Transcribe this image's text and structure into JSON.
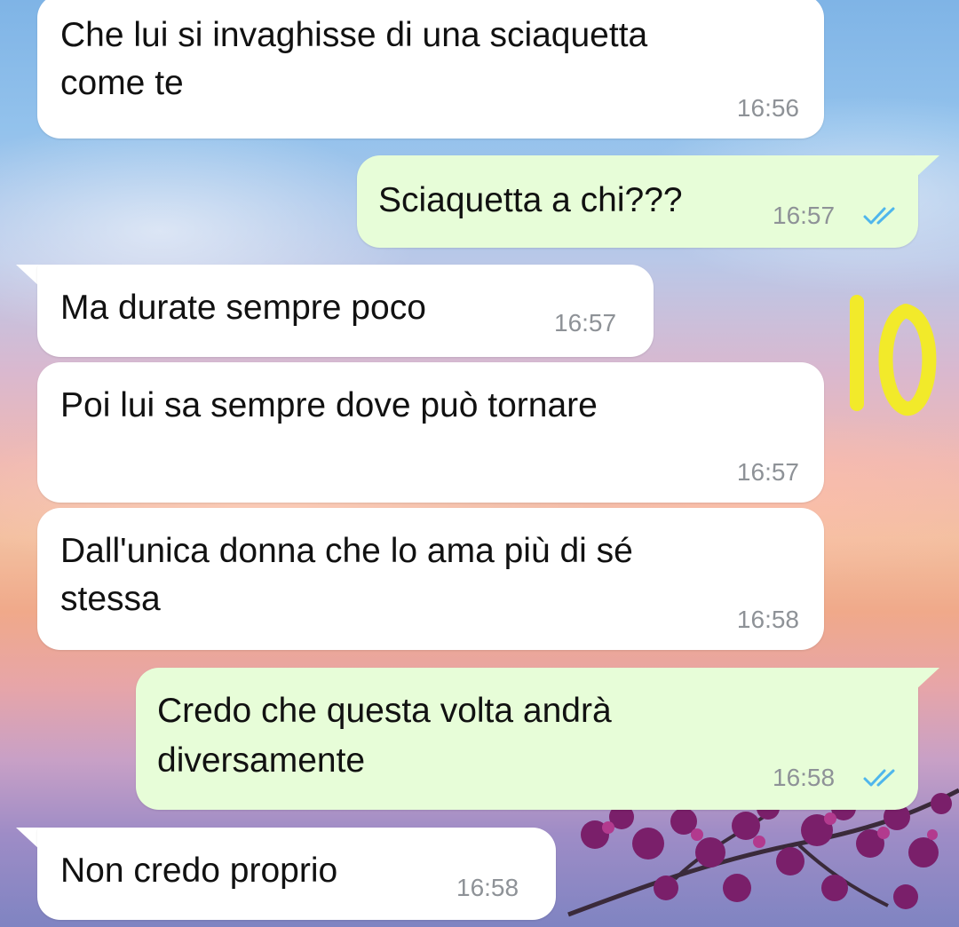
{
  "conversation": {
    "messages": [
      {
        "direction": "incoming",
        "text_lines": [
          "Che lui si invaghisse di una sciaquetta",
          "come te"
        ],
        "time": "16:56"
      },
      {
        "direction": "outgoing",
        "text_lines": [
          "Sciaquetta a chi???"
        ],
        "time": "16:57",
        "status": "read"
      },
      {
        "direction": "incoming",
        "text_lines": [
          "Ma durate sempre poco"
        ],
        "time": "16:57"
      },
      {
        "direction": "incoming",
        "text_lines": [
          "Poi lui sa sempre dove può tornare"
        ],
        "time": "16:57"
      },
      {
        "direction": "incoming",
        "text_lines": [
          "Dall'unica donna che lo ama più di sé",
          "stessa"
        ],
        "time": "16:58"
      },
      {
        "direction": "outgoing",
        "text_lines": [
          "Credo che questa volta andrà",
          "diversamente"
        ],
        "time": "16:58",
        "status": "read"
      },
      {
        "direction": "incoming",
        "text_lines": [
          "Non credo proprio"
        ],
        "time": "16:58"
      }
    ]
  },
  "colors": {
    "incoming_bubble": "#ffffff",
    "outgoing_bubble": "#e7fdd8",
    "read_ticks": "#4fb6ec",
    "timestamp": "#8e9297",
    "annotation": "#f2ea2a"
  },
  "icons": {
    "read_receipt": "double-check-icon"
  }
}
